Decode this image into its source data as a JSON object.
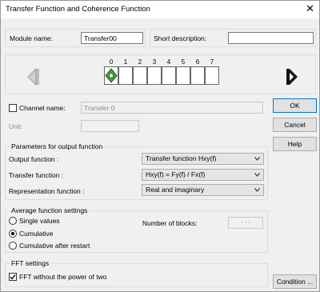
{
  "window": {
    "title": "Transfer Function and Coherence Function",
    "close_glyph": "✕"
  },
  "module": {
    "name_label": "Module name:",
    "name_value": "Transfer00",
    "short_desc_label": "Short description:",
    "short_desc_value": ""
  },
  "channels": {
    "slots": [
      "0",
      "1",
      "2",
      "3",
      "4",
      "5",
      "6",
      "7"
    ]
  },
  "channel_name": {
    "label": "Channel name:",
    "value": "Transfer 0",
    "checked": false
  },
  "unit": {
    "label": "Unit:",
    "value": ""
  },
  "output_params": {
    "title": "Parameters for output function",
    "output_label": "Output function :",
    "output_value": "Transfer function Hxy(f)",
    "transfer_label": "Transfer function :",
    "transfer_value": "Hxy(f) = Fy(f) / Fx(f)",
    "repr_label": "Representation function :",
    "repr_value": "Real and imaginary"
  },
  "average": {
    "title": "Average function settings",
    "options": [
      "Single values",
      "Cumulative",
      "Cumulative after restart"
    ],
    "selected_index": 1,
    "blocks_label": "Number of blocks:",
    "blocks_value": "- - -"
  },
  "fft": {
    "title": "FFT settings",
    "checkbox_label": "FFT without the power of two",
    "checked": true
  },
  "buttons": {
    "ok": "OK",
    "cancel": "Cancel",
    "help": "Help",
    "condition": "Condition ..."
  },
  "icons": {
    "left_arrow": "arrow-left-icon",
    "right_arrow": "arrow-right-icon",
    "module": "module-diamond-icon"
  },
  "colors": {
    "accent": "#0078d7",
    "slot_active": "#3fa33f"
  }
}
